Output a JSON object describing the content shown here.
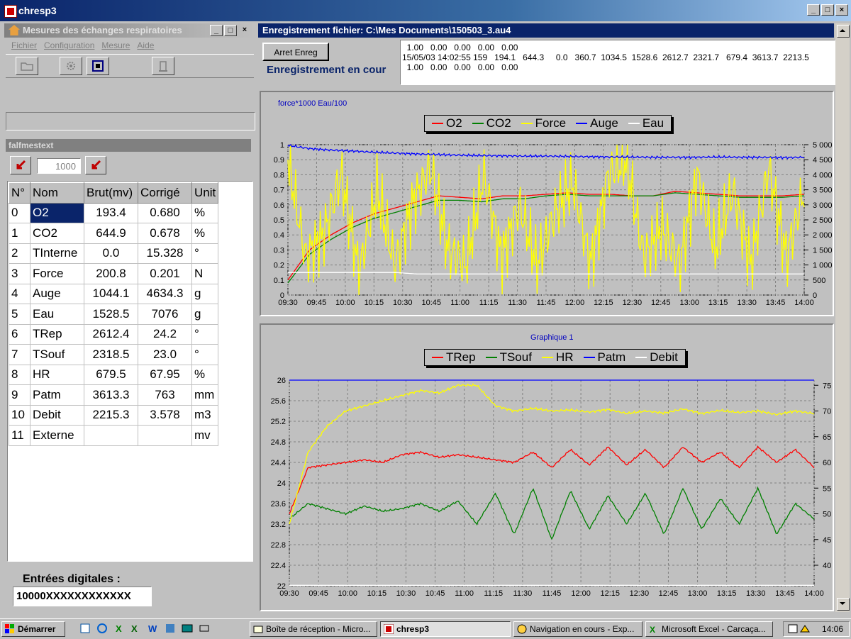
{
  "app": {
    "title": "chresp3"
  },
  "left_window": {
    "title": "Mesures des échanges respiratoires",
    "menu": [
      "Fichier",
      "Configuration",
      "Mesure",
      "Aide"
    ],
    "measure_table_title": "falfmestext",
    "interval_value": "1000",
    "columns": [
      "N°",
      "Nom",
      "Brut(mv)",
      "Corrigé",
      "Unit"
    ],
    "rows": [
      [
        "0",
        "O2",
        "193.4",
        "0.680",
        "%"
      ],
      [
        "1",
        "CO2",
        "644.9",
        "0.678",
        "%"
      ],
      [
        "2",
        "TInterne",
        "0.0",
        "15.328",
        "°"
      ],
      [
        "3",
        "Force",
        "200.8",
        "0.201",
        "N"
      ],
      [
        "4",
        "Auge",
        "1044.1",
        "4634.3",
        "g"
      ],
      [
        "5",
        "Eau",
        "1528.5",
        "7076",
        "g"
      ],
      [
        "6",
        "TRep",
        "2612.4",
        "24.2",
        "°"
      ],
      [
        "7",
        "TSouf",
        "2318.5",
        "23.0",
        "°"
      ],
      [
        "8",
        "HR",
        "679.5",
        "67.95",
        "%"
      ],
      [
        "9",
        "Patm",
        "3613.3",
        "763",
        "mm"
      ],
      [
        "10",
        "Debit",
        "2215.3",
        "3.578",
        "m3"
      ],
      [
        "11",
        "Externe",
        "",
        "",
        "mv"
      ]
    ],
    "digital_inputs_label": "Entrées digitales :",
    "digital_inputs_value": "10000XXXXXXXXXXXX"
  },
  "right_window": {
    "title": "Enregistrement fichier: C:\\Mes Documents\\150503_3.au4",
    "stop_button": "Arret Enreg",
    "status": "Enregistrement en cour",
    "data_lines": [
      "  1.00   0.00   0.00   0.00   0.00",
      "15/05/03 14:02:55 159   194.1   644.3     0.0   360.7  1034.5  1528.6  2612.7  2321.7   679.4  3613.7  2213.5",
      "  1.00   0.00   0.00   0.00   0.00"
    ]
  },
  "chart_data": [
    {
      "type": "line",
      "title": "force*1000 Eau/100",
      "legend": [
        "O2",
        "CO2",
        "Force",
        "Auge",
        "Eau"
      ],
      "colors": [
        "#ff0000",
        "#008000",
        "#ffff00",
        "#0000ff",
        "#ffffff"
      ],
      "x_ticks": [
        "09:30",
        "09:45",
        "10:00",
        "10:15",
        "10:30",
        "10:45",
        "11:00",
        "11:15",
        "11:30",
        "11:45",
        "12:00",
        "12:15",
        "12:30",
        "12:45",
        "13:00",
        "13:15",
        "13:30",
        "13:45",
        "14:00"
      ],
      "y_left_ticks": [
        "0",
        "0.1",
        "0.2",
        "0.3",
        "0.4",
        "0.5",
        "0.6",
        "0.7",
        "0.8",
        "0.9",
        "1"
      ],
      "y_right_ticks": [
        "0",
        "500",
        "1 000",
        "1 500",
        "2 000",
        "2 500",
        "3 000",
        "3 500",
        "4 000",
        "4 500",
        "5 000"
      ],
      "ylim_left": [
        0,
        1
      ],
      "ylim_right": [
        0,
        5000
      ],
      "grid": true,
      "series": [
        {
          "name": "O2",
          "axis": "left",
          "values": [
            0.1,
            0.3,
            0.4,
            0.48,
            0.54,
            0.58,
            0.62,
            0.66,
            0.65,
            0.64,
            0.66,
            0.66,
            0.67,
            0.68,
            0.67,
            0.67,
            0.66,
            0.66,
            0.69,
            0.68,
            0.67,
            0.66,
            0.66,
            0.66,
            0.67
          ]
        },
        {
          "name": "CO2",
          "axis": "left",
          "values": [
            0.08,
            0.27,
            0.37,
            0.45,
            0.51,
            0.55,
            0.59,
            0.63,
            0.63,
            0.62,
            0.64,
            0.64,
            0.66,
            0.67,
            0.66,
            0.66,
            0.66,
            0.66,
            0.68,
            0.67,
            0.66,
            0.65,
            0.65,
            0.65,
            0.66
          ]
        },
        {
          "name": "Force",
          "axis": "left",
          "values": [
            0.9,
            0.25,
            0.4,
            0.8,
            0.15,
            0.7,
            0.2,
            0.6,
            0.85,
            0.3,
            0.2,
            0.8,
            0.25,
            0.6,
            0.2,
            0.55,
            0.75,
            0.2,
            0.8,
            0.9,
            0.25,
            0.45,
            0.2,
            0.8,
            0.3,
            0.7,
            0.2,
            0.85,
            0.25,
            0.7
          ]
        },
        {
          "name": "Auge",
          "axis": "right",
          "values": [
            4980,
            4870,
            4820,
            4790,
            4750,
            4720,
            4690,
            4670,
            4650,
            4640,
            4630,
            4620,
            4620,
            4610,
            4600,
            4590,
            4590,
            4580,
            4580,
            4580,
            4590,
            4580,
            4580,
            4570,
            4580
          ]
        },
        {
          "name": "Eau",
          "axis": "left",
          "values": [
            0.15,
            0.15,
            0.15,
            0.15,
            0.15,
            0.15,
            0.14,
            0.14,
            0.14,
            0.14,
            0.14,
            0.14,
            0.14,
            0.14,
            0.14,
            0.14,
            0.14,
            0.14,
            0.14,
            0.14,
            0.14,
            0.14,
            0.14,
            0.14,
            0.14
          ]
        }
      ]
    },
    {
      "type": "line",
      "title": "Graphique 1",
      "legend": [
        "TRep",
        "TSouf",
        "HR",
        "Patm",
        "Debit"
      ],
      "colors": [
        "#ff0000",
        "#008000",
        "#ffff00",
        "#0000ff",
        "#ffffff"
      ],
      "x_ticks": [
        "09:30",
        "09:45",
        "10:00",
        "10:15",
        "10:30",
        "10:45",
        "11:00",
        "11:15",
        "11:30",
        "11:45",
        "12:00",
        "12:15",
        "12:30",
        "12:45",
        "13:00",
        "13:15",
        "13:30",
        "13:45",
        "14:00"
      ],
      "y_left_ticks": [
        "22",
        "22.4",
        "22.8",
        "23.2",
        "23.6",
        "24",
        "24.4",
        "24.8",
        "25.2",
        "25.6",
        "26"
      ],
      "y_right_ticks": [
        "40",
        "45",
        "50",
        "55",
        "60",
        "65",
        "70",
        "75"
      ],
      "ylim_left": [
        22,
        26
      ],
      "ylim_right": [
        36,
        76
      ],
      "grid": true,
      "series": [
        {
          "name": "TRep",
          "axis": "left",
          "values": [
            23.4,
            24.3,
            24.35,
            24.4,
            24.45,
            24.4,
            24.55,
            24.6,
            24.5,
            24.55,
            24.5,
            24.45,
            24.4,
            24.6,
            24.3,
            24.65,
            24.35,
            24.7,
            24.35,
            24.65,
            24.3,
            24.7,
            24.4,
            24.6,
            24.3,
            24.7,
            24.4,
            24.65,
            24.3
          ]
        },
        {
          "name": "TSouf",
          "axis": "left",
          "values": [
            23.3,
            23.6,
            23.5,
            23.4,
            23.55,
            23.45,
            23.5,
            23.6,
            23.45,
            23.65,
            23.2,
            23.8,
            23.0,
            23.9,
            22.9,
            23.85,
            23.1,
            23.75,
            23.2,
            23.8,
            23.0,
            23.9,
            23.1,
            23.7,
            23.2,
            23.9,
            23.0,
            23.6,
            23.3
          ]
        },
        {
          "name": "HR",
          "axis": "right",
          "values": [
            48,
            62,
            67,
            70,
            71,
            72,
            73,
            74,
            73.5,
            75,
            75,
            71,
            70,
            70.5,
            70,
            70.2,
            69.8,
            70.3,
            69.5,
            70,
            69.6,
            70.4,
            69.5,
            70.1,
            69.7,
            70,
            69.3,
            70,
            69.5
          ]
        },
        {
          "name": "Patm",
          "axis": "right",
          "values": [
            76,
            76,
            76,
            76,
            76,
            76,
            76,
            76,
            76,
            76,
            76,
            76,
            76,
            76,
            76,
            76,
            76,
            76,
            76,
            76,
            76,
            76,
            76,
            76,
            76,
            76,
            76,
            76,
            76
          ]
        },
        {
          "name": "Debit",
          "axis": "right",
          "values": [
            36.1,
            36.1,
            36.1,
            36.1,
            36.1,
            36.1,
            36.1,
            36.1,
            36.1,
            36.1,
            36.1,
            36.1,
            36.1,
            36.1,
            36.1,
            36.1,
            36.1,
            36.1,
            36.1,
            36.1,
            36.1,
            36.1,
            36.1,
            36.1,
            36.1,
            36.1,
            36.1,
            36.1,
            36.1
          ]
        }
      ]
    }
  ],
  "taskbar": {
    "start": "Démarrer",
    "tasks": [
      "Boîte de réception - Micro...",
      "chresp3",
      "Navigation en cours - Exp...",
      "Microsoft Excel - Carcaça..."
    ],
    "clock": "14:06"
  }
}
